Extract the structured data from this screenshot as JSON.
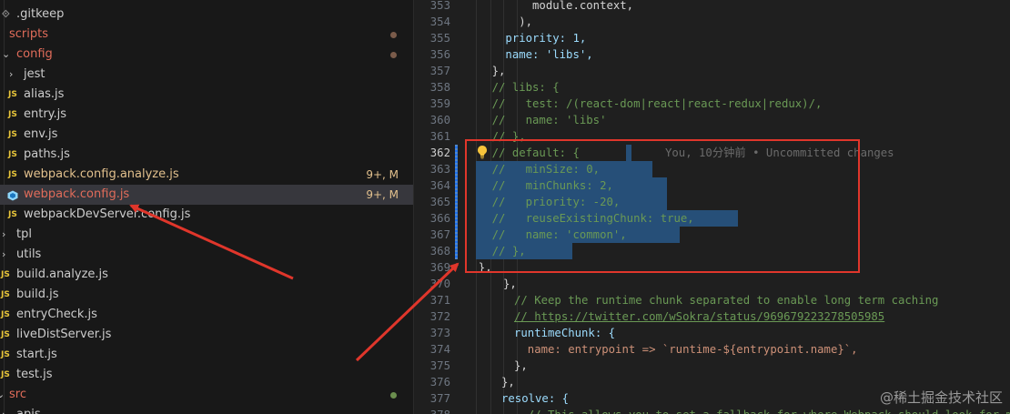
{
  "explorer": {
    "items": [
      {
        "label": ".gitkeep",
        "type": "file-generic"
      },
      {
        "label": "scripts",
        "type": "folder-open-root",
        "color": "red"
      },
      {
        "label": "config",
        "type": "folder-open",
        "color": "red"
      },
      {
        "label": "jest",
        "type": "folder-closed"
      },
      {
        "label": "alias.js",
        "type": "js"
      },
      {
        "label": "entry.js",
        "type": "js"
      },
      {
        "label": "env.js",
        "type": "js"
      },
      {
        "label": "paths.js",
        "type": "js"
      },
      {
        "label": "webpack.config.analyze.js",
        "type": "js",
        "color": "modified",
        "badge": "9+, M"
      },
      {
        "label": "webpack.config.js",
        "type": "webpack",
        "color": "red",
        "badge": "9+, M",
        "selected": true
      },
      {
        "label": "webpackDevServer.config.js",
        "type": "js"
      },
      {
        "label": "tpl",
        "type": "folder-closed-root"
      },
      {
        "label": "utils",
        "type": "folder-closed-root"
      },
      {
        "label": "build.analyze.js",
        "type": "js-root"
      },
      {
        "label": "build.js",
        "type": "js-root"
      },
      {
        "label": "entryCheck.js",
        "type": "js-root"
      },
      {
        "label": "liveDistServer.js",
        "type": "js-root"
      },
      {
        "label": "start.js",
        "type": "js-root"
      },
      {
        "label": "test.js",
        "type": "js-root"
      },
      {
        "label": "src",
        "type": "folder-open-top",
        "color": "red"
      },
      {
        "label": "apis",
        "type": "folder-closed"
      }
    ]
  },
  "editor": {
    "lines": [
      {
        "n": "353",
        "text": "          module.context,"
      },
      {
        "n": "354",
        "text": "        ),"
      },
      {
        "n": "355",
        "text": "      priority: 1,"
      },
      {
        "n": "356",
        "text": "      name: 'libs',"
      },
      {
        "n": "357",
        "text": "    },"
      },
      {
        "n": "358",
        "text": "    // libs: {"
      },
      {
        "n": "359",
        "text": "    //   test: /(react-dom|react|react-redux|redux)/,"
      },
      {
        "n": "360",
        "text": "    //   name: 'libs'"
      },
      {
        "n": "361",
        "text": "    // },"
      },
      {
        "n": "362",
        "text": "    // default: {"
      },
      {
        "n": "363",
        "text": "    //   minSize: 0,"
      },
      {
        "n": "364",
        "text": "    //   minChunks: 2,"
      },
      {
        "n": "365",
        "text": "    //   priority: -20,"
      },
      {
        "n": "366",
        "text": "    //   reuseExistingChunk: true,"
      },
      {
        "n": "367",
        "text": "    //   name: 'common',"
      },
      {
        "n": "368",
        "text": "    // },"
      },
      {
        "n": "369",
        "text": "  },"
      },
      {
        "n": "370",
        "text": "},"
      },
      {
        "n": "371",
        "text": "// Keep the runtime chunk separated to enable long term caching"
      },
      {
        "n": "372",
        "text": "// https://twitter.com/wSokra/status/969679223278505985"
      },
      {
        "n": "373",
        "text": "runtimeChunk: {"
      },
      {
        "n": "374",
        "text": "  name: entrypoint => `runtime-${entrypoint.name}`,"
      },
      {
        "n": "375",
        "text": "},"
      },
      {
        "n": "376",
        "text": "},"
      },
      {
        "n": "377",
        "text": "resolve: {"
      },
      {
        "n": "378",
        "text": "  // This allows you to set a fallback for where Webpack should look for modu"
      }
    ],
    "blame_text": "You, 10分钟前 • Uncommitted changes",
    "active_line": "362"
  },
  "watermark": "@稀土掘金技术社区"
}
